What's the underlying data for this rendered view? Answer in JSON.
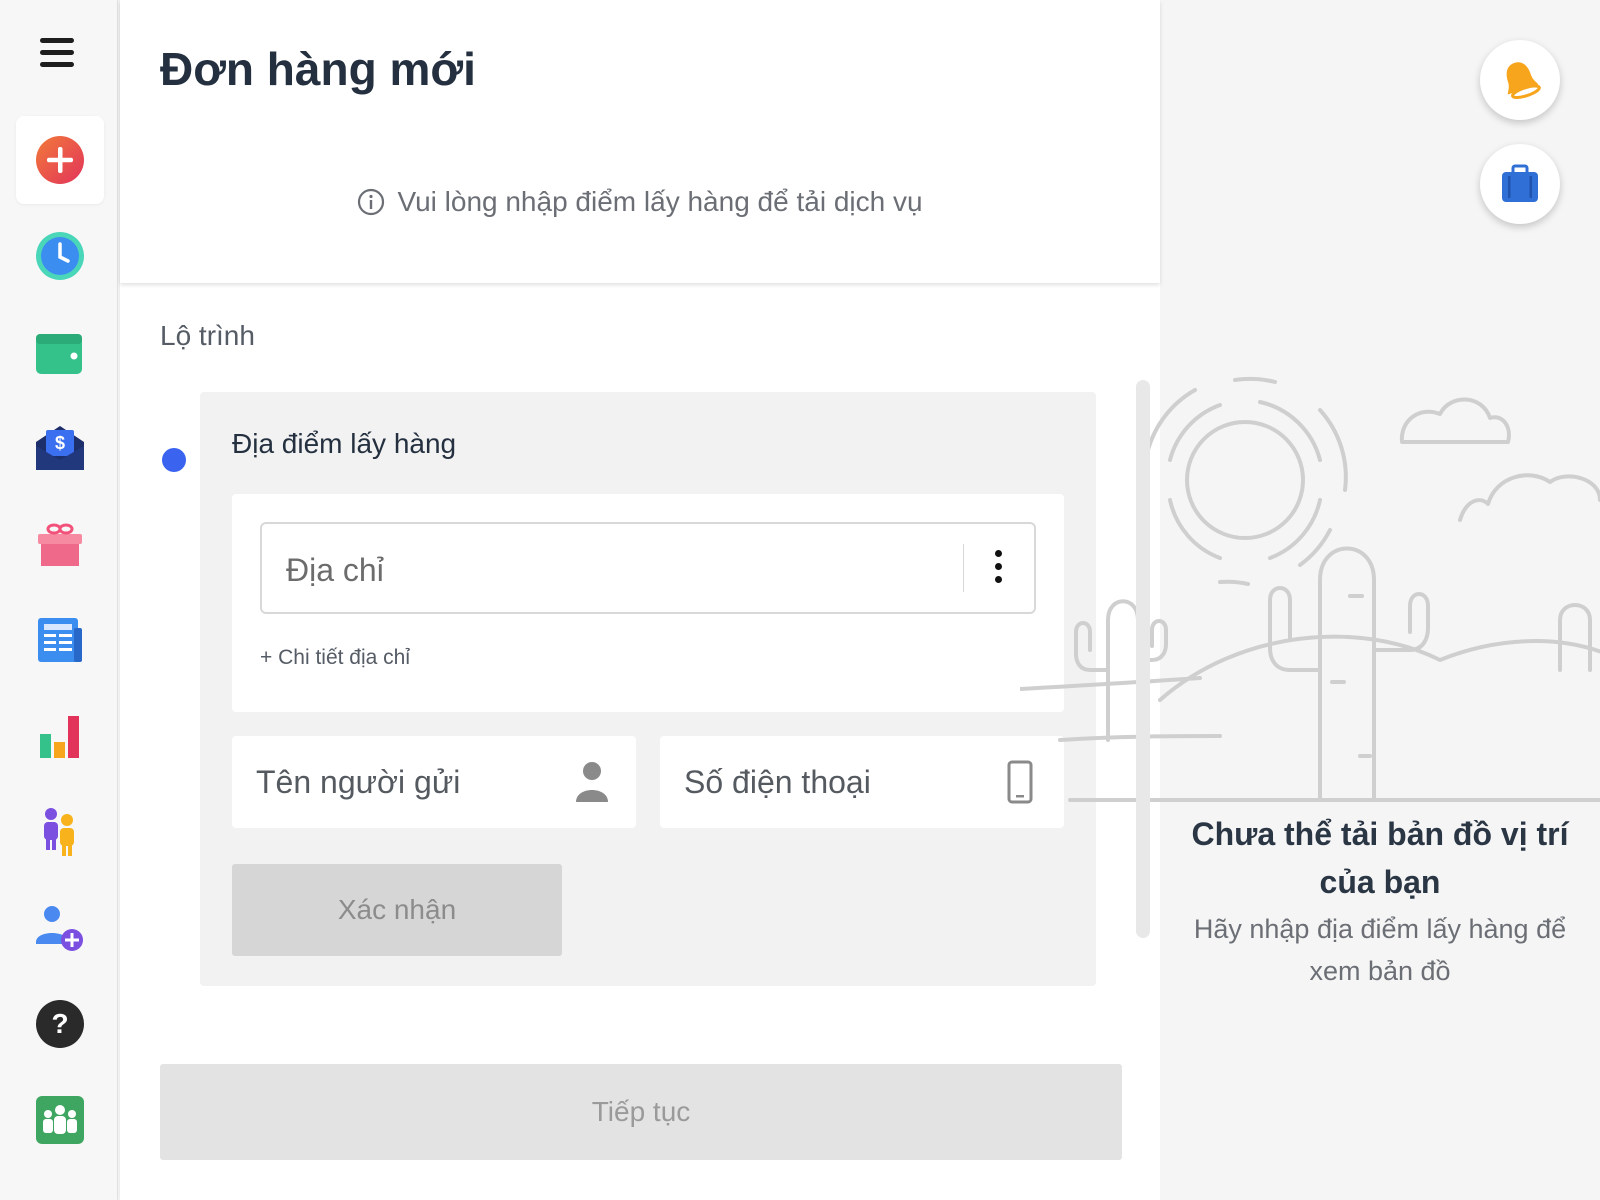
{
  "header": {
    "title": "Đơn hàng mới",
    "info_text": "Vui lòng nhập điểm lấy hàng để tải dịch vụ"
  },
  "sidebar": {
    "items": [
      {
        "name": "new-order",
        "icon": "add-circle-icon"
      },
      {
        "name": "history",
        "icon": "clock-icon"
      },
      {
        "name": "wallet",
        "icon": "wallet-icon"
      },
      {
        "name": "payment",
        "icon": "money-envelope-icon"
      },
      {
        "name": "gifts",
        "icon": "gift-icon"
      },
      {
        "name": "reports",
        "icon": "document-icon"
      },
      {
        "name": "statistics",
        "icon": "bar-chart-icon"
      },
      {
        "name": "drivers",
        "icon": "people-icon"
      },
      {
        "name": "invite",
        "icon": "add-user-icon"
      },
      {
        "name": "help",
        "icon": "help-icon"
      },
      {
        "name": "community",
        "icon": "group-icon"
      }
    ]
  },
  "route": {
    "section_label": "Lộ trình",
    "pickup_title": "Địa điểm lấy hàng",
    "address_placeholder": "Địa chỉ",
    "address_detail_link": "+ Chi tiết địa chỉ",
    "sender_placeholder": "Tên người gửi",
    "phone_placeholder": "Số điện thoại",
    "confirm_label": "Xác nhận"
  },
  "footer": {
    "continue_label": "Tiếp tục"
  },
  "map": {
    "title": "Chưa thể tải bản đồ vị trí của bạn",
    "subtitle": "Hãy nhập địa điểm lấy hàng để xem bản đồ"
  },
  "colors": {
    "accent_blue": "#3a63f0",
    "bell_orange": "#f7a51c",
    "bag_blue": "#2f6fd6"
  }
}
